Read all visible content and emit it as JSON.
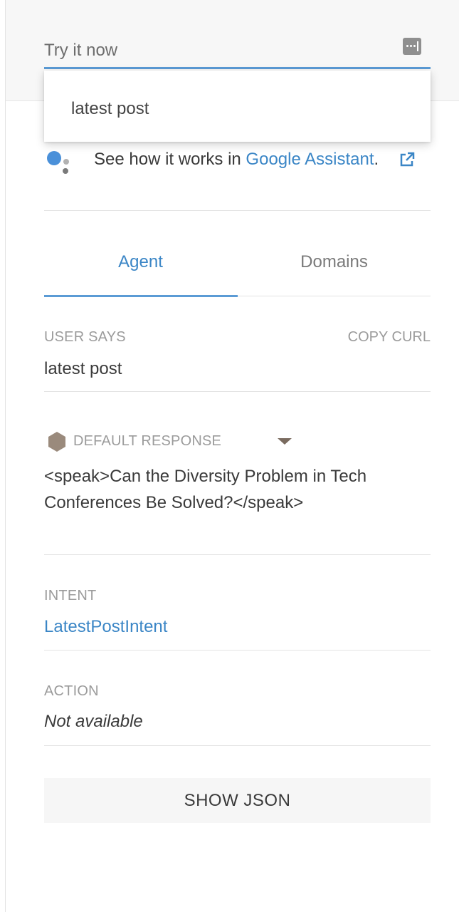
{
  "try_it": {
    "placeholder": "Try it now",
    "mic_icon": "microphone-icon"
  },
  "suggestion": {
    "text": "latest post"
  },
  "assistant": {
    "prefix": "See how it works in ",
    "link_text": "Google Assistant",
    "suffix": ".",
    "icon": "google-assistant-icon",
    "external_icon": "external-link-icon"
  },
  "tabs": [
    {
      "label": "Agent",
      "active": true
    },
    {
      "label": "Domains",
      "active": false
    }
  ],
  "user_says": {
    "label": "USER SAYS",
    "copy_curl": "COPY CURL",
    "value": "latest post"
  },
  "response": {
    "label": "DEFAULT RESPONSE",
    "icon": "hexagon-icon",
    "dropdown_icon": "caret-down-icon",
    "text": "<speak>Can the Diversity Problem in Tech Conferences Be Solved?</speak>"
  },
  "intent": {
    "label": "INTENT",
    "value": "LatestPostIntent"
  },
  "action": {
    "label": "ACTION",
    "value": "Not available"
  },
  "show_json": {
    "label": "SHOW JSON"
  },
  "colors": {
    "accent": "#5b9bd5",
    "link": "#3b86c6",
    "muted": "#9b9b9b"
  }
}
